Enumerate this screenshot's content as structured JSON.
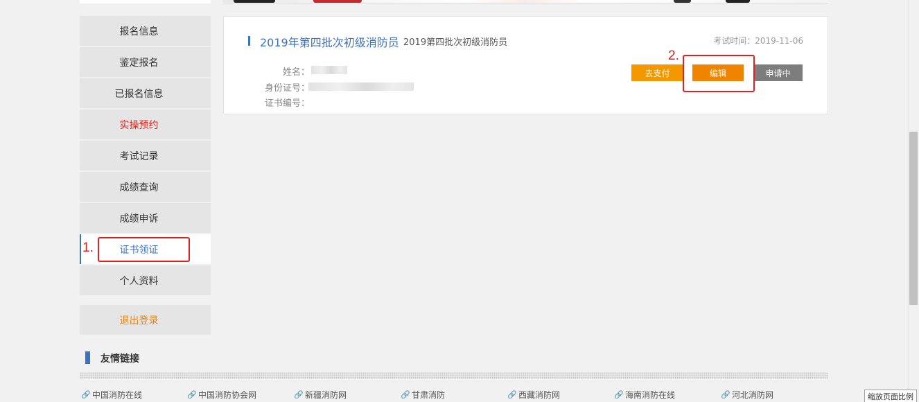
{
  "sidebar": {
    "items": [
      {
        "label": "报名信息"
      },
      {
        "label": "鉴定报名"
      },
      {
        "label": "已报名信息"
      },
      {
        "label": "实操预约"
      },
      {
        "label": "考试记录"
      },
      {
        "label": "成绩查询"
      },
      {
        "label": "成绩申诉"
      },
      {
        "label": "证书领证"
      },
      {
        "label": "个人资料"
      }
    ],
    "logout": "退出登录"
  },
  "annotations": {
    "step1": "1.",
    "step2": "2."
  },
  "card": {
    "title": "2019年第四批次初级消防员",
    "subtitle": "2019第四批次初级消防员",
    "exam_time": "考试时间：2019-11-06",
    "name_label": "姓名：",
    "id_label": "身份证号：",
    "cert_label": "证书编号：",
    "buttons": {
      "pay": "去支付",
      "edit": "编辑",
      "applying": "申请中"
    }
  },
  "friend_links": {
    "title": "友情链接",
    "items": [
      {
        "label": "中国消防在线"
      },
      {
        "label": "中国消防协会网"
      },
      {
        "label": "新疆消防网"
      },
      {
        "label": "甘肃消防"
      },
      {
        "label": "西藏消防网"
      },
      {
        "label": "海南消防在线"
      },
      {
        "label": "河北消防网"
      }
    ]
  },
  "zoom_tooltip": "缩放页面比例",
  "colors": {
    "accent_blue": "#3c72c4",
    "highlight_red": "#e3221b",
    "orange": "#f08300",
    "gray_button": "#7d7d7d"
  }
}
